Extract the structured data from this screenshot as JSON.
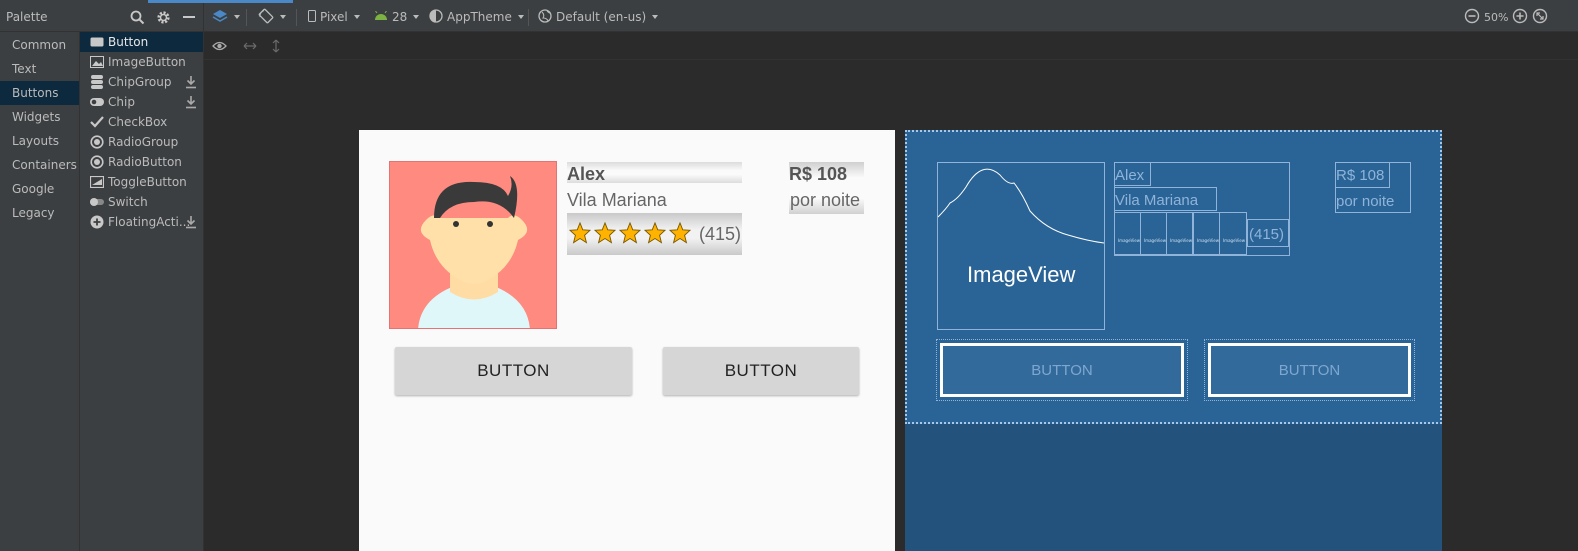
{
  "palette": {
    "title": "Palette",
    "categories": [
      "Common",
      "Text",
      "Buttons",
      "Widgets",
      "Layouts",
      "Containers",
      "Google",
      "Legacy"
    ],
    "selected_category": "Buttons",
    "items": [
      {
        "label": "Button",
        "icon": "button-icon"
      },
      {
        "label": "ImageButton",
        "icon": "image-icon"
      },
      {
        "label": "ChipGroup",
        "icon": "chipgroup-icon"
      },
      {
        "label": "Chip",
        "icon": "chip-icon"
      },
      {
        "label": "CheckBox",
        "icon": "check-icon"
      },
      {
        "label": "RadioGroup",
        "icon": "radio-icon"
      },
      {
        "label": "RadioButton",
        "icon": "radio-icon"
      },
      {
        "label": "ToggleButton",
        "icon": "toggle-icon"
      },
      {
        "label": "Switch",
        "icon": "switch-icon"
      },
      {
        "label": "FloatingActi...",
        "icon": "plus-icon"
      }
    ]
  },
  "toolbar": {
    "device": "Pixel",
    "api": "28",
    "theme": "AppTheme",
    "locale": "Default (en-us)",
    "zoom": "50%"
  },
  "design": {
    "name": "Alex",
    "place": "Vila Mariana",
    "rating_count": "(415)",
    "price": "R$ 108",
    "per_night": "por noite",
    "button1": "BUTTON",
    "button2": "BUTTON",
    "stars": 5
  },
  "blueprint": {
    "imageview_label": "ImageView",
    "name": "Alex",
    "place": "Vila Mariana",
    "rating_count": "(415)",
    "price": "R$ 108",
    "per_night": "por noite",
    "button1": "BUTTON",
    "button2": "BUTTON",
    "mini_label": "ImageView"
  },
  "colors": {
    "accent": "#4a88c7",
    "selection": "#0d293e",
    "blueprint": "#23527c",
    "avatar_bg": "#ff8a80"
  }
}
